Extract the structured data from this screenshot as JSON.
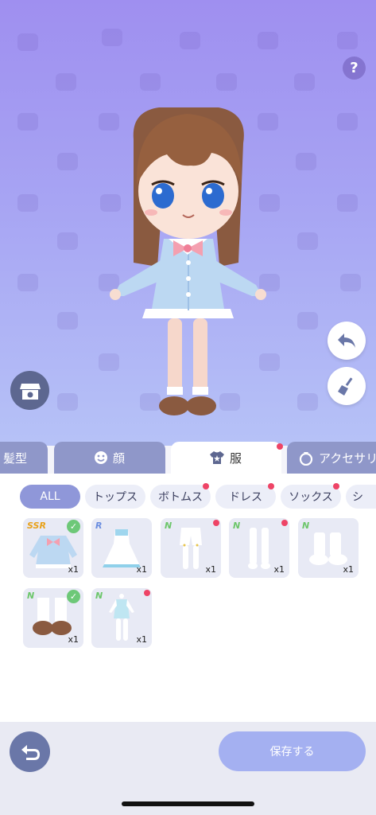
{
  "help": {
    "label": "?"
  },
  "tabs": [
    {
      "label": "髪型",
      "icon": "hair-icon",
      "active": false,
      "badge": false
    },
    {
      "label": "顔",
      "icon": "face-icon",
      "active": false,
      "badge": false
    },
    {
      "label": "服",
      "icon": "shirt-icon",
      "active": true,
      "badge": true
    },
    {
      "label": "アクセサリ",
      "icon": "ring-icon",
      "active": false,
      "badge": false
    }
  ],
  "filters": [
    {
      "label": "ALL",
      "active": true,
      "badge": false
    },
    {
      "label": "トップス",
      "active": false,
      "badge": false
    },
    {
      "label": "ボトムス",
      "active": false,
      "badge": true
    },
    {
      "label": "ドレス",
      "active": false,
      "badge": true
    },
    {
      "label": "ソックス",
      "active": false,
      "badge": true
    },
    {
      "label": "シ",
      "active": false,
      "badge": false
    }
  ],
  "items": [
    {
      "rarity": "SSR",
      "qty": "x1",
      "equipped": true,
      "badge": false,
      "kind": "blue-jacket"
    },
    {
      "rarity": "R",
      "qty": "x1",
      "equipped": false,
      "badge": false,
      "kind": "white-dress"
    },
    {
      "rarity": "N",
      "qty": "x1",
      "equipped": false,
      "badge": true,
      "kind": "white-shorts"
    },
    {
      "rarity": "N",
      "qty": "x1",
      "equipped": false,
      "badge": true,
      "kind": "white-socks"
    },
    {
      "rarity": "N",
      "qty": "x1",
      "equipped": false,
      "badge": true,
      "kind": "white-shoes"
    },
    {
      "rarity": "N",
      "qty": "x1",
      "equipped": true,
      "badge": false,
      "kind": "brown-shoes"
    },
    {
      "rarity": "N",
      "qty": "x1",
      "equipped": false,
      "badge": true,
      "kind": "light-blue-dress"
    }
  ],
  "colors": {
    "SSR": "#e8a21c",
    "R": "#6b8ee0",
    "N": "#6cc66a"
  },
  "save": {
    "label": "保存する"
  }
}
